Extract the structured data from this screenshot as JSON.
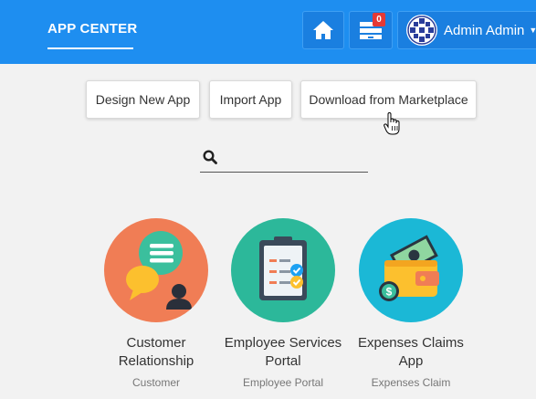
{
  "header": {
    "title": "APP CENTER",
    "notification_count": "0",
    "user_name": "Admin Admin",
    "home_icon": "home-icon",
    "inbox_icon": "inbox-icon",
    "accent": "#1e8ef0"
  },
  "actions": {
    "design": "Design New App",
    "import": "Import App",
    "marketplace": "Download from Marketplace"
  },
  "search": {
    "placeholder": "",
    "value": ""
  },
  "apps": [
    {
      "title": "Customer Relationship",
      "subtitle": "Customer",
      "icon": "chat-person-icon",
      "color": "#f07d55"
    },
    {
      "title": "Employee Services Portal",
      "subtitle": "Employee Portal",
      "icon": "clipboard-checklist-icon",
      "color": "#2cb89a"
    },
    {
      "title": "Expenses Claims App",
      "subtitle": "Expenses Claim",
      "icon": "wallet-money-icon",
      "color": "#1bb8d6"
    }
  ]
}
